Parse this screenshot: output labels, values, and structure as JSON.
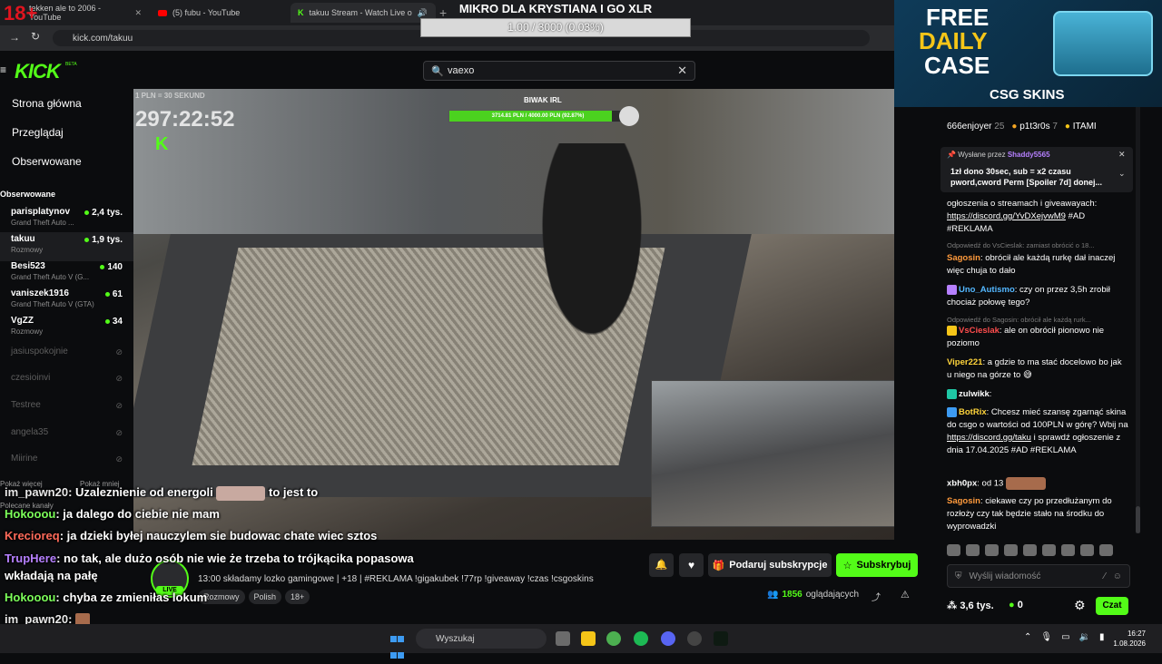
{
  "browser": {
    "tabs": [
      {
        "label": "tekken ale to 2006 - YouTube"
      },
      {
        "label": "(5) fubu - YouTube"
      },
      {
        "label": "takuu Stream - Watch Live o"
      }
    ],
    "url": "kick.com/takuu"
  },
  "overlay": {
    "age_badge": "18+",
    "goal_title": "MIKRO DLA KRYSTIANA I GO XLR",
    "goal_progress_text": "1.00 / 3000 (0.03%)",
    "goal_progress": 0.0003,
    "donation_goal_label": "BIWAK IRL",
    "donation_text": "3714.81 PLN / 4000.00 PLN (92.87%)",
    "donation_progress": 0.9287,
    "timer_label": "1 PLN = 30 SEKUND",
    "timer": "297:22:52",
    "timer_logo": "K"
  },
  "ad": {
    "line1": "FREE",
    "line2": "DAILY",
    "line3": "CASE",
    "brand": "CSG SKINS"
  },
  "header": {
    "logo": "KICK",
    "beta": "BETA",
    "search_value": "vaexo"
  },
  "sidebar": {
    "nav": [
      {
        "label": "Strona główna"
      },
      {
        "label": "Przeglądaj"
      },
      {
        "label": "Obserwowane"
      }
    ],
    "followed_header": "Obserwowane",
    "channels": [
      {
        "name": "parisplatynov",
        "game": "Grand Theft Auto ...",
        "viewers": "2,4 tys."
      },
      {
        "name": "takuu",
        "game": "Rozmowy",
        "viewers": "1,9 tys."
      },
      {
        "name": "Besi523",
        "game": "Grand Theft Auto V (G...",
        "viewers": "140"
      },
      {
        "name": "vaniszek1916",
        "game": "Grand Theft Auto V (GTA)",
        "viewers": "61"
      },
      {
        "name": "VgZZ",
        "game": "Rozmowy",
        "viewers": "34"
      }
    ],
    "offline": [
      {
        "name": "jasiuspokojnie"
      },
      {
        "name": "czesioinvi"
      },
      {
        "name": "Testree"
      },
      {
        "name": "angela35"
      },
      {
        "name": "Miirine"
      }
    ],
    "show_more": "Pokaż więcej",
    "show_less": "Pokaż mniej",
    "recommended_header": "Polecane kanały"
  },
  "stream": {
    "title": "13:00 składamy lozko gamingowe | +18 | #REKLAMA !gigakubek !77rp !giveaway !czas !csgoskins",
    "tags": [
      "Rozmowy",
      "Polish",
      "18+"
    ],
    "live": "LIVE",
    "gift_label": "Podaruj subskrypcje",
    "sub_label": "Subskrybuj",
    "viewers_count": "1856",
    "viewers_label": "oglądających"
  },
  "overlay_chat": [
    {
      "user": "im_pawn20",
      "text": ": Uzaleznienie od energoli",
      "tail": "to jest to",
      "color": "#e8e8e8"
    },
    {
      "user": "Hokooou",
      "text": ": ja dalego do ciebie nie mam",
      "color": "#7cff5a"
    },
    {
      "user": "Krecioreq",
      "text": ": ja dzieki byłej nauczylem sie budowac chate wiec sztos",
      "color": "#ff6a5a"
    },
    {
      "user": "TrupHere",
      "text": ": no tak, ale dużo osób nie wie że trzeba to trójkącika popasowa",
      "color": "#b680ff"
    },
    {
      "user": "",
      "text": "wkładają na pałę",
      "color": "#ffffff"
    },
    {
      "user": "Hokooou",
      "text": ": chyba ze zmieniłas lokum",
      "color": "#7cff5a"
    },
    {
      "user": "im_pawn20",
      "text": ":",
      "color": "#e8e8e8"
    },
    {
      "user": "im_pawn20",
      "text": ":",
      "color": "#e8e8e8"
    }
  ],
  "chat": {
    "leaderboard": [
      {
        "name": "666enjoyer",
        "count": "25"
      },
      {
        "name": "p1t3r0s",
        "count": "7"
      },
      {
        "name": "ITAMI",
        "count": ""
      }
    ],
    "pinned_by_label": "Wysłane przez",
    "pinned_by_user": "Shaddy5565",
    "pinned_text": "1zł dono 30sec, sub = x2 czasu pword,cword Perm [Spoiler 7d] donej...",
    "messages": [
      {
        "user": "",
        "text": "ogłoszenia o streamach i giveawayach:",
        "link": "https://discord.gg/YvDXejvwM9",
        "tail": "#AD #REKLAMA",
        "color": "#ffffff"
      },
      {
        "reply": "Odpowiedź do VsCieslak: zamiast obrócić o 18..."
      },
      {
        "user": "Sagosin",
        "text": ": obrócił ale każdą rurkę dał inaczej więc chuja to dało",
        "color": "#ff9a3c"
      },
      {
        "user": "Uno_Autismo",
        "text": ": czy on przez 3,5h zrobił chociaż połowę tego?",
        "color": "#53b7ff"
      },
      {
        "reply": "Odpowiedź do Sagosin: obrócił ale każdą rurk..."
      },
      {
        "user": "VsCieslak",
        "text": ": ale on obrócił pionowo nie poziomo",
        "color": "#ff4d4d"
      },
      {
        "user": "Viper221",
        "text": ": a gdzie to ma stać docelowo bo jak u niego na górze to",
        "color": "#ffd43b"
      },
      {
        "user": "zulwikk",
        "text": ":",
        "color": "#ffffff"
      },
      {
        "user": "BotRix",
        "text": ": Chcesz mieć szansę zgarnąć skina do csgo o wartości od 100PLN w górę? Wbij na",
        "link": "https://discord.gg/taku",
        "tail": "i sprawdź ogłoszenie z dnia 17.04.2025 #AD #REKLAMA",
        "color": "#ffd43b"
      },
      {
        "user": "xbh0px",
        "text": ": od 13",
        "color": "#ffffff"
      },
      {
        "user": "Sagosin",
        "text": ": ciekawe czy po przedłużanym do rozłoży czy tak będzie stało na środku do wyprowadzki",
        "color": "#ff9a3c"
      }
    ],
    "input_placeholder": "Wyślij wiadomość",
    "points": "3,6 tys.",
    "green_points": "0",
    "chat_button": "Czat"
  },
  "taskbar": {
    "search_placeholder": "Wyszukaj",
    "time": "16:27",
    "date": "1.08.2026"
  },
  "colors": {
    "kick_green": "#53fc18",
    "background": "#0b0c0e",
    "panel": "#1c1d20"
  }
}
